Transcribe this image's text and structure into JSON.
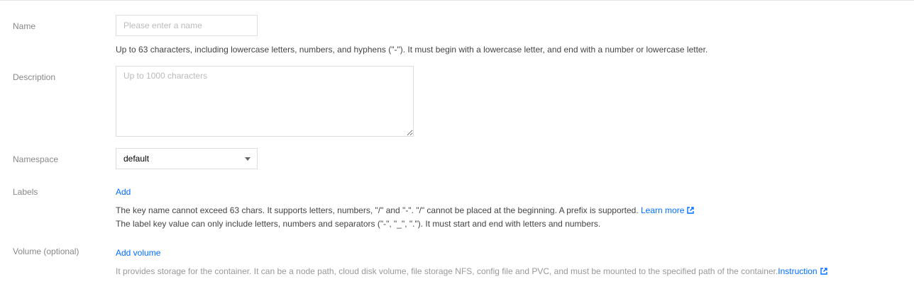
{
  "form": {
    "name": {
      "label": "Name",
      "placeholder": "Please enter a name",
      "hint": "Up to 63 characters, including lowercase letters, numbers, and hyphens (\"-\"). It must begin with a lowercase letter, and end with a number or lowercase letter."
    },
    "description": {
      "label": "Description",
      "placeholder": "Up to 1000 characters"
    },
    "namespace": {
      "label": "Namespace",
      "value": "default"
    },
    "labels": {
      "label": "Labels",
      "add_label": "Add",
      "hint_line1": "The key name cannot exceed 63 chars. It supports letters, numbers, \"/\" and \"-\". \"/\" cannot be placed at the beginning. A prefix is supported.",
      "learn_more": "Learn more",
      "hint_line2": "The label key value can only include letters, numbers and separators (\"-\", \"_\", \".\"). It must start and end with letters and numbers."
    },
    "volume": {
      "label": "Volume (optional)",
      "add_label": "Add volume",
      "hint": "It provides storage for the container. It can be a node path, cloud disk volume, file storage NFS, config file and PVC, and must be mounted to the specified path of the container.",
      "instruction": "Instruction"
    }
  },
  "colors": {
    "link": "#006eff",
    "label": "#888888",
    "border": "#dddddd"
  }
}
